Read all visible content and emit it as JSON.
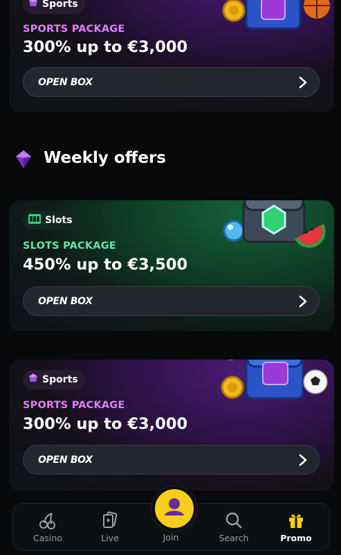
{
  "cards": [
    {
      "badge": "Sports",
      "badge_icon": "sports-gem-icon",
      "label": "SPORTS PACKAGE",
      "label_color": "#e07dff",
      "amount": "300% up to €3,000",
      "button": "OPEN BOX"
    },
    {
      "badge": "Slots",
      "badge_icon": "slot-machine-icon",
      "label": "SLOTS PACKAGE",
      "label_color": "#5fe8a6",
      "amount": "450% up to €3,500",
      "button": "OPEN BOX"
    },
    {
      "badge": "Sports",
      "badge_icon": "sports-gem-icon",
      "label": "SPORTS PACKAGE",
      "label_color": "#e07dff",
      "amount": "300% up to €3,000",
      "button": "OPEN BOX"
    }
  ],
  "section": {
    "title": "Weekly offers",
    "icon": "purple-gem-icon"
  },
  "nav": {
    "items": [
      {
        "label": "Casino",
        "icon": "cherries-icon"
      },
      {
        "label": "Live",
        "icon": "cards-icon"
      },
      {
        "label": "Join",
        "icon": "user-icon"
      },
      {
        "label": "Search",
        "icon": "search-icon"
      },
      {
        "label": "Promo",
        "icon": "gift-icon",
        "active": true
      }
    ]
  },
  "colors": {
    "accent_yellow": "#f6cf1a",
    "sports_purple": "#e07dff",
    "slots_green": "#5fe8a6"
  }
}
